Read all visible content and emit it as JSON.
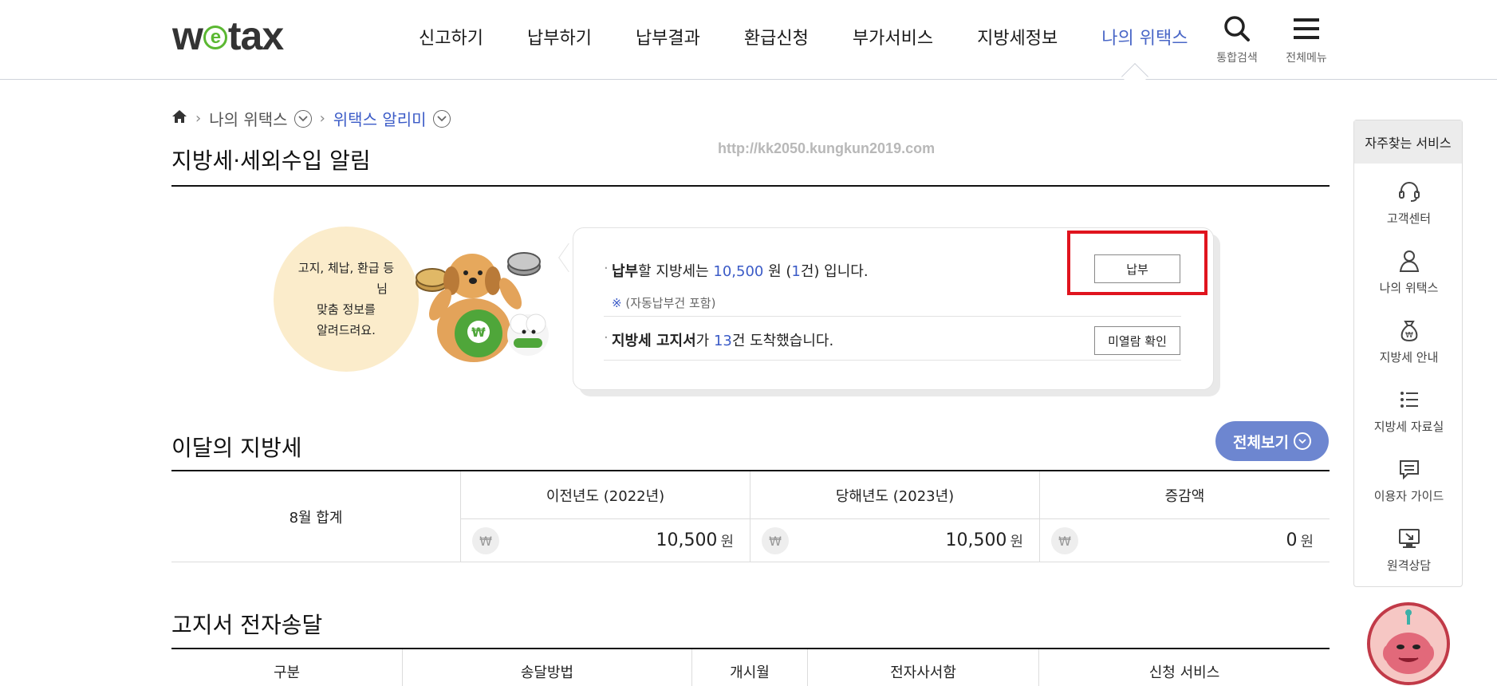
{
  "header": {
    "logo": {
      "w": "w",
      "e": "e",
      "tax": "tax"
    },
    "nav": [
      {
        "label": "신고하기"
      },
      {
        "label": "납부하기"
      },
      {
        "label": "납부결과"
      },
      {
        "label": "환급신청"
      },
      {
        "label": "부가서비스"
      },
      {
        "label": "지방세정보"
      },
      {
        "label": "나의 위택스"
      }
    ],
    "search_label": "통합검색",
    "menu_label": "전체메뉴",
    "accent_color": "#4a67c7"
  },
  "breadcrumb": {
    "level1": "나의 위택스",
    "level2": "위택스 알리미"
  },
  "watermark": "http://kk2050.kungkun2019.com",
  "notice": {
    "title": "지방세·세외수입 알림",
    "bubble_line1": "고지, 체납, 환급 등",
    "bubble_line2": "님",
    "bubble_line3": "맞춤 정보를",
    "bubble_line4": "알려드려요.",
    "row1": {
      "bold": "납부",
      "text1": "할 지방세는 ",
      "amount": "10,500",
      "text2": " 원 (",
      "count": "1",
      "text3": "건) 입니다.",
      "sub_mark": "※",
      "sub_text": " (자동납부건 포함)",
      "button": "납부"
    },
    "row2": {
      "bold": "지방세 고지서",
      "text1": "가 ",
      "count": "13",
      "text2": "건 도착했습니다.",
      "button": "미열람 확인"
    },
    "highlight_color": "#e0141e"
  },
  "monthly": {
    "title": "이달의 지방세",
    "view_all": "전체보기",
    "row_label": "8월 합계",
    "columns": [
      "이전년도 (2022년)",
      "당해년도 (2023년)",
      "증감액"
    ],
    "currency_icon": "₩",
    "unit": "원",
    "values": [
      "10,500",
      "10,500",
      "0"
    ]
  },
  "delivery": {
    "title": "고지서 전자송달",
    "columns": [
      "구분",
      "송달방법",
      "개시월",
      "전자사서함",
      "신청 서비스"
    ]
  },
  "quick_menu": {
    "title": "자주찾는 서비스",
    "items": [
      {
        "label": "고객센터",
        "icon": "headset-icon"
      },
      {
        "label": "나의 위택스",
        "icon": "user-icon"
      },
      {
        "label": "지방세 안내",
        "icon": "money-bag-icon"
      },
      {
        "label": "지방세 자료실",
        "icon": "list-icon"
      },
      {
        "label": "이용자 가이드",
        "icon": "chat-icon"
      },
      {
        "label": "원격상담",
        "icon": "monitor-icon"
      }
    ]
  }
}
